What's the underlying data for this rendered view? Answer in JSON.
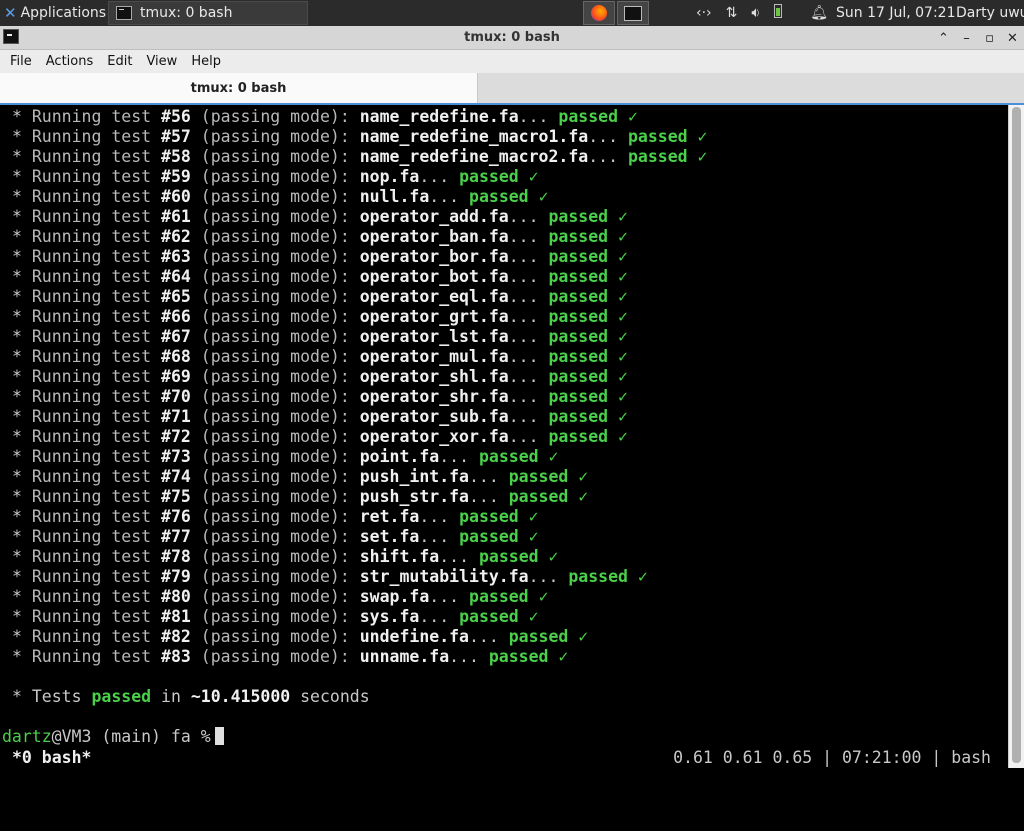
{
  "panel": {
    "applications_label": "Applications",
    "task_label": "tmux: 0 bash",
    "clock": "Sun 17 Jul, 07:21",
    "user": "Darty uwu",
    "tray_icons": [
      "network-icon",
      "transfer-icon",
      "volume-icon",
      "battery-icon",
      "notification-bell-icon"
    ]
  },
  "window": {
    "title": "tmux: 0 bash",
    "menu": [
      "File",
      "Actions",
      "Edit",
      "View",
      "Help"
    ],
    "tab_label": "tmux: 0 bash",
    "accent_color": "#4a90d9"
  },
  "terminal": {
    "line_prefix": "* ",
    "running": "Running test ",
    "mode": "(passing mode):",
    "passed_word": "passed",
    "check": "✓",
    "tests": [
      {
        "num": "#56",
        "file": "name_redefine.fa"
      },
      {
        "num": "#57",
        "file": "name_redefine_macro1.fa"
      },
      {
        "num": "#58",
        "file": "name_redefine_macro2.fa"
      },
      {
        "num": "#59",
        "file": "nop.fa"
      },
      {
        "num": "#60",
        "file": "null.fa"
      },
      {
        "num": "#61",
        "file": "operator_add.fa"
      },
      {
        "num": "#62",
        "file": "operator_ban.fa"
      },
      {
        "num": "#63",
        "file": "operator_bor.fa"
      },
      {
        "num": "#64",
        "file": "operator_bot.fa"
      },
      {
        "num": "#65",
        "file": "operator_eql.fa"
      },
      {
        "num": "#66",
        "file": "operator_grt.fa"
      },
      {
        "num": "#67",
        "file": "operator_lst.fa"
      },
      {
        "num": "#68",
        "file": "operator_mul.fa"
      },
      {
        "num": "#69",
        "file": "operator_shl.fa"
      },
      {
        "num": "#70",
        "file": "operator_shr.fa"
      },
      {
        "num": "#71",
        "file": "operator_sub.fa"
      },
      {
        "num": "#72",
        "file": "operator_xor.fa"
      },
      {
        "num": "#73",
        "file": "point.fa"
      },
      {
        "num": "#74",
        "file": "push_int.fa"
      },
      {
        "num": "#75",
        "file": "push_str.fa"
      },
      {
        "num": "#76",
        "file": "ret.fa"
      },
      {
        "num": "#77",
        "file": "set.fa"
      },
      {
        "num": "#78",
        "file": "shift.fa"
      },
      {
        "num": "#79",
        "file": "str_mutability.fa"
      },
      {
        "num": "#80",
        "file": "swap.fa"
      },
      {
        "num": "#81",
        "file": "sys.fa"
      },
      {
        "num": "#82",
        "file": "undefine.fa"
      },
      {
        "num": "#83",
        "file": "unname.fa"
      }
    ],
    "summary": {
      "prefix": "* Tests ",
      "passed": "passed",
      "middle": " in ",
      "time": "~10.415000",
      "suffix": " seconds"
    },
    "prompt": {
      "user": "dartz",
      "host": "@VM3",
      "branch": " (main)",
      "dir": " fa",
      "symbol": " %"
    },
    "status_left": "*0 bash*",
    "status_right": "0.61 0.61 0.65 | 07:21:00 | bash",
    "colors": {
      "passed": "#4ad04a",
      "prompt_user": "#4ad04a"
    }
  }
}
